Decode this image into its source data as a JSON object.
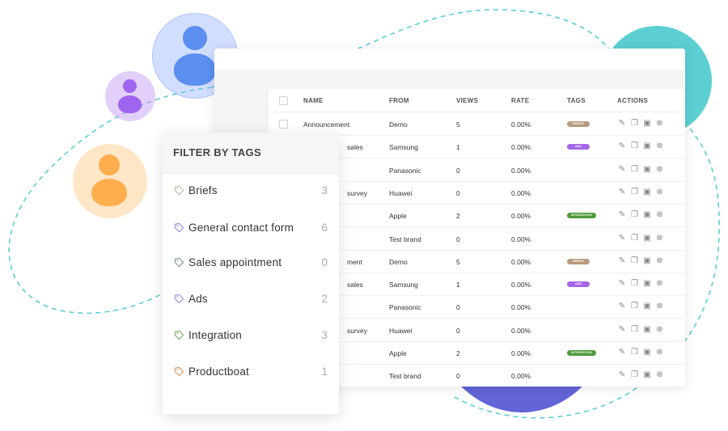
{
  "colors": {
    "teal_blob": "#5ccfd3",
    "purple_blob": "#6264d8",
    "dashed_line": "#5ccfd3",
    "tag_briefs": "#b79a7e",
    "tag_ads": "#a666e8",
    "tag_integration": "#4e9a3a"
  },
  "table": {
    "columns": {
      "name": "NAME",
      "from": "FROM",
      "views": "VIEWS",
      "rate": "RATE",
      "tags": "TAGS",
      "actions": "ACTIONS"
    },
    "rows": [
      {
        "name": "Announcement",
        "from": "Demo",
        "views": "5",
        "rate": "0.00%",
        "tag": "BRIEFS",
        "tag_color": "#b79a7e"
      },
      {
        "name": "sales",
        "from": "Samsung",
        "views": "1",
        "rate": "0.00%",
        "tag": "ADS",
        "tag_color": "#a666e8"
      },
      {
        "name": "",
        "from": "Panasonic",
        "views": "0",
        "rate": "0.00%",
        "tag": "",
        "tag_color": ""
      },
      {
        "name": "survey",
        "from": "Huawei",
        "views": "0",
        "rate": "0.00%",
        "tag": "",
        "tag_color": ""
      },
      {
        "name": "",
        "from": "Apple",
        "views": "2",
        "rate": "0.00%",
        "tag": "INTEGRATION",
        "tag_color": "#4e9a3a"
      },
      {
        "name": "",
        "from": "Test brand",
        "views": "0",
        "rate": "0.00%",
        "tag": "",
        "tag_color": ""
      },
      {
        "name": "ment",
        "from": "Demo",
        "views": "5",
        "rate": "0.00%",
        "tag": "BRIEFS",
        "tag_color": "#b79a7e"
      },
      {
        "name": "sales",
        "from": "Samsung",
        "views": "1",
        "rate": "0.00%",
        "tag": "ADS",
        "tag_color": "#a666e8"
      },
      {
        "name": "",
        "from": "Panasonic",
        "views": "0",
        "rate": "0.00%",
        "tag": "",
        "tag_color": ""
      },
      {
        "name": "survey",
        "from": "Huawei",
        "views": "0",
        "rate": "0.00%",
        "tag": "",
        "tag_color": ""
      },
      {
        "name": "",
        "from": "Apple",
        "views": "2",
        "rate": "0.00%",
        "tag": "INTEGRATION",
        "tag_color": "#4e9a3a"
      },
      {
        "name": "",
        "from": "Test brand",
        "views": "0",
        "rate": "0.00%",
        "tag": "",
        "tag_color": ""
      }
    ],
    "row_actions": [
      "edit-icon",
      "copy-icon",
      "archive-icon",
      "delete-icon"
    ]
  },
  "filter": {
    "title": "FILTER BY TAGS",
    "items": [
      {
        "label": "Briefs",
        "count": "3",
        "icon": "tag-icon",
        "color": "#c9b9a8"
      },
      {
        "label": "General contact form",
        "count": "6",
        "icon": "tag-icon",
        "color": "#a58be0"
      },
      {
        "label": "Sales appointment",
        "count": "0",
        "icon": "tag-icon",
        "color": "#8a9a9a"
      },
      {
        "label": "Ads",
        "count": "2",
        "icon": "tag-icon",
        "color": "#a58be0"
      },
      {
        "label": "Integration",
        "count": "3",
        "icon": "tag-icon",
        "color": "#7bb06a"
      },
      {
        "label": "Productboat",
        "count": "1",
        "icon": "tag-icon",
        "color": "#d19a6a"
      }
    ]
  }
}
